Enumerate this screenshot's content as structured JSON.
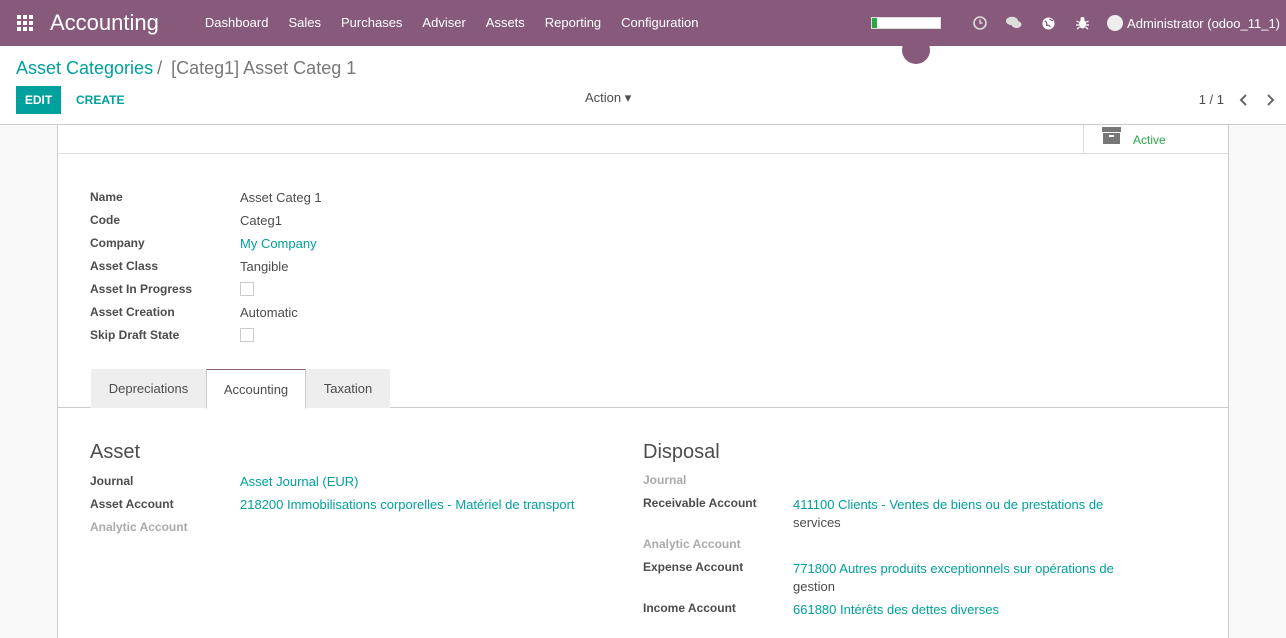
{
  "navbar": {
    "app_title": "Accounting",
    "menu": [
      "Dashboard",
      "Sales",
      "Purchases",
      "Adviser",
      "Assets",
      "Reporting",
      "Configuration"
    ],
    "progress_fraction": 0.08,
    "user": "Administrator (odoo_11_1)"
  },
  "breadcrumb": {
    "parent": "Asset Categories",
    "separator": "/",
    "current": "[Categ1] Asset Categ 1"
  },
  "buttons": {
    "edit": "EDIT",
    "create": "CREATE",
    "action": "Action ▾"
  },
  "pager": {
    "value": "1 / 1"
  },
  "status": {
    "active": "Active"
  },
  "fields": {
    "name": {
      "label": "Name",
      "value": "Asset Categ 1"
    },
    "code": {
      "label": "Code",
      "value": "Categ1"
    },
    "company": {
      "label": "Company",
      "value": "My Company"
    },
    "asset_class": {
      "label": "Asset Class",
      "value": "Tangible"
    },
    "asset_in_progress": {
      "label": "Asset In Progress",
      "checked": false
    },
    "asset_creation": {
      "label": "Asset Creation",
      "value": "Automatic"
    },
    "skip_draft": {
      "label": "Skip Draft State",
      "checked": false
    }
  },
  "tabs": [
    "Depreciations",
    "Accounting",
    "Taxation"
  ],
  "active_tab": "Accounting",
  "asset_group": {
    "title": "Asset",
    "journal": {
      "label": "Journal",
      "value": "Asset Journal (EUR)"
    },
    "asset_account": {
      "label": "Asset Account",
      "value": "218200 Immobilisations corporelles - Matériel de transport"
    },
    "analytic_account": {
      "label": "Analytic Account",
      "value": ""
    }
  },
  "disposal_group": {
    "title": "Disposal",
    "journal": {
      "label": "Journal",
      "value": ""
    },
    "receivable_account": {
      "label": "Receivable Account",
      "value_link": "411100 Clients - Ventes de biens ou de prestations de",
      "value_rest": "services"
    },
    "analytic_account": {
      "label": "Analytic Account",
      "value": ""
    },
    "expense_account": {
      "label": "Expense Account",
      "value_link": "771800 Autres produits exceptionnels sur opérations de",
      "value_rest": "gestion"
    },
    "income_account": {
      "label": "Income Account",
      "value": "661880 Intérêts des dettes diverses"
    }
  }
}
